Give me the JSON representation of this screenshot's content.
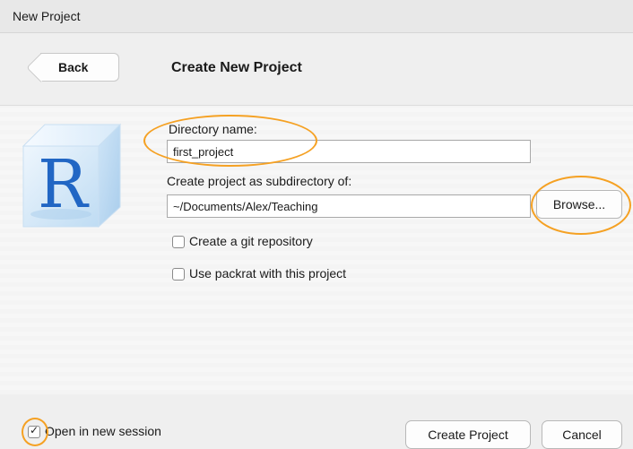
{
  "window": {
    "title": "New Project"
  },
  "header": {
    "back_label": "Back",
    "heading": "Create New Project"
  },
  "form": {
    "directory_label": "Directory name:",
    "directory_value": "first_project",
    "subdir_label": "Create project as subdirectory of:",
    "subdir_value": "~/Documents/Alex/Teaching",
    "browse_label": "Browse...",
    "git_label": "Create a git repository",
    "git_checked": false,
    "packrat_label": "Use packrat with this project",
    "packrat_checked": false
  },
  "footer": {
    "new_session_label": "Open in new session",
    "new_session_checked": true,
    "create_label": "Create Project",
    "cancel_label": "Cancel"
  },
  "logo": {
    "icon": "r-logo-icon",
    "letter": "R"
  },
  "colors": {
    "annotation": "#f5a123",
    "header_bg": "#efefef",
    "r_blue": "#2166c4"
  }
}
